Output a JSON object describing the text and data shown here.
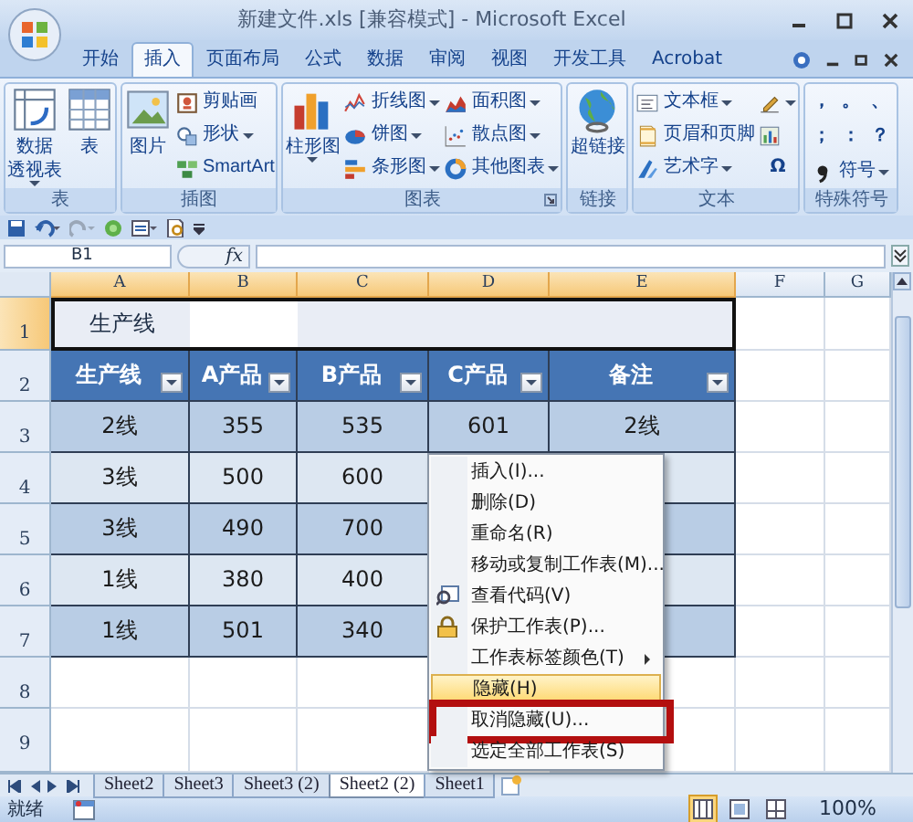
{
  "window": {
    "title": "新建文件.xls  [兼容模式] - Microsoft Excel"
  },
  "ribbon_tabs": [
    {
      "label": "开始",
      "selected": false
    },
    {
      "label": "插入",
      "selected": true
    },
    {
      "label": "页面布局",
      "selected": false
    },
    {
      "label": "公式",
      "selected": false
    },
    {
      "label": "数据",
      "selected": false
    },
    {
      "label": "审阅",
      "selected": false
    },
    {
      "label": "视图",
      "selected": false
    },
    {
      "label": "开发工具",
      "selected": false
    },
    {
      "label": "Acrobat",
      "selected": false
    }
  ],
  "ribbon_groups": [
    {
      "label": "表",
      "launcher": false,
      "columns": [
        [
          {
            "kind": "large",
            "lines": [
              "数据",
              "透视表"
            ],
            "dropdown": true
          }
        ],
        [
          {
            "kind": "large",
            "lines": [
              "表"
            ],
            "dropdown": false
          }
        ]
      ]
    },
    {
      "label": "插图",
      "launcher": false,
      "columns": [
        [
          {
            "kind": "large",
            "lines": [
              "图片"
            ],
            "dropdown": false
          }
        ],
        [
          {
            "kind": "small",
            "lines": [
              "剪贴画"
            ],
            "dropdown": false
          },
          {
            "kind": "small",
            "lines": [
              "形状"
            ],
            "dropdown": true
          },
          {
            "kind": "small",
            "lines": [
              "SmartArt"
            ],
            "dropdown": false
          }
        ]
      ]
    },
    {
      "label": "图表",
      "launcher": true,
      "columns": [
        [
          {
            "kind": "large",
            "lines": [
              "柱形图"
            ],
            "dropdown": true
          }
        ],
        [
          {
            "kind": "small",
            "lines": [
              "折线图"
            ],
            "dropdown": true
          },
          {
            "kind": "small",
            "lines": [
              "饼图"
            ],
            "dropdown": true
          },
          {
            "kind": "small",
            "lines": [
              "条形图"
            ],
            "dropdown": true
          }
        ],
        [
          {
            "kind": "small",
            "lines": [
              "面积图"
            ],
            "dropdown": true
          },
          {
            "kind": "small",
            "lines": [
              "散点图"
            ],
            "dropdown": true
          },
          {
            "kind": "small",
            "lines": [
              "其他图表"
            ],
            "dropdown": true
          }
        ]
      ]
    },
    {
      "label": "链接",
      "launcher": false,
      "columns": [
        [
          {
            "kind": "large",
            "lines": [
              "超链接"
            ],
            "dropdown": false
          }
        ]
      ]
    },
    {
      "label": "文本",
      "launcher": false,
      "columns": [
        [
          {
            "kind": "small",
            "lines": [
              "文本框"
            ],
            "dropdown": true
          },
          {
            "kind": "small",
            "lines": [
              "页眉和页脚"
            ],
            "dropdown": false
          },
          {
            "kind": "small",
            "lines": [
              "艺术字"
            ],
            "dropdown": true
          }
        ],
        [
          {
            "kind": "icon",
            "dropdown": true
          },
          {
            "kind": "icon",
            "dropdown": false
          },
          {
            "kind": "glyph",
            "lines": [
              "Ω"
            ],
            "dropdown": false
          }
        ]
      ]
    },
    {
      "label": "特殊符号",
      "launcher": false,
      "items": [
        {
          "kind": "glyph",
          "lines": [
            "，"
          ],
          "dropdown": false
        },
        {
          "kind": "glyph",
          "lines": [
            "。"
          ],
          "dropdown": false
        },
        {
          "kind": "glyph",
          "lines": [
            "、"
          ],
          "dropdown": false
        },
        {
          "kind": "glyph",
          "lines": [
            "；"
          ],
          "dropdown": false
        },
        {
          "kind": "glyph",
          "lines": [
            "："
          ],
          "dropdown": false
        },
        {
          "kind": "glyph",
          "lines": [
            "？"
          ],
          "dropdown": false
        },
        {
          "kind": "small",
          "lines": [
            "符号"
          ],
          "dropdown": true
        }
      ]
    }
  ],
  "formula_bar": {
    "name_box": "B1",
    "function_label": "fx"
  },
  "sheet": {
    "columns": [
      {
        "label": "A",
        "selected": true
      },
      {
        "label": "B",
        "selected": true
      },
      {
        "label": "C",
        "selected": true
      },
      {
        "label": "D",
        "selected": true
      },
      {
        "label": "E",
        "selected": true
      },
      {
        "label": "F",
        "selected": false
      },
      {
        "label": "G",
        "selected": false
      }
    ],
    "row_numbers": [
      {
        "label": "1",
        "selected": true
      },
      {
        "label": "2",
        "selected": false
      },
      {
        "label": "3",
        "selected": false
      },
      {
        "label": "4",
        "selected": false
      },
      {
        "label": "5",
        "selected": false
      },
      {
        "label": "6",
        "selected": false
      },
      {
        "label": "7",
        "selected": false
      },
      {
        "label": "8",
        "selected": false
      },
      {
        "label": "9",
        "selected": false
      }
    ],
    "title_cell": "生产线",
    "table": {
      "headers": [
        "生产线",
        "A产品",
        "B产品",
        "C产品",
        "备注"
      ],
      "rows": [
        [
          "2线",
          "355",
          "535",
          "601",
          "2线"
        ],
        [
          "3线",
          "500",
          "600"
        ],
        [
          "3线",
          "490",
          "700"
        ],
        [
          "1线",
          "380",
          "400"
        ],
        [
          "1线",
          "501",
          "340"
        ]
      ]
    }
  },
  "context_menu": [
    {
      "label": "插入(I)...",
      "kind": "plain",
      "submenu": false,
      "selected": false,
      "annotated": false
    },
    {
      "label": "删除(D)",
      "kind": "plain",
      "submenu": false,
      "selected": false,
      "annotated": false
    },
    {
      "label": "重命名(R)",
      "kind": "plain",
      "submenu": false,
      "selected": false,
      "annotated": false
    },
    {
      "label": "移动或复制工作表(M)...",
      "kind": "plain",
      "submenu": false,
      "selected": false,
      "annotated": false
    },
    {
      "label": "查看代码(V)",
      "kind": "view-code",
      "submenu": false,
      "selected": false,
      "annotated": false
    },
    {
      "label": "保护工作表(P)...",
      "kind": "protect",
      "submenu": false,
      "selected": false,
      "annotated": false
    },
    {
      "label": "工作表标签颜色(T)",
      "kind": "plain",
      "submenu": true,
      "selected": false,
      "annotated": false
    },
    {
      "label": "隐藏(H)",
      "kind": "plain",
      "submenu": false,
      "selected": true,
      "annotated": false
    },
    {
      "label": "取消隐藏(U)...",
      "kind": "plain",
      "submenu": false,
      "selected": false,
      "annotated": true
    },
    {
      "label": "选定全部工作表(S)",
      "kind": "plain",
      "submenu": false,
      "selected": false,
      "annotated": false
    }
  ],
  "sheet_tabs": [
    {
      "label": "Sheet2",
      "selected": false
    },
    {
      "label": "Sheet3",
      "selected": false
    },
    {
      "label": "Sheet3 (2)",
      "selected": false
    },
    {
      "label": "Sheet2 (2)",
      "selected": true
    },
    {
      "label": "Sheet1",
      "selected": false
    }
  ],
  "status_bar": {
    "status": "就绪",
    "views": [
      {
        "selected": true
      },
      {
        "selected": false
      },
      {
        "selected": false
      }
    ],
    "zoom": "100%"
  }
}
